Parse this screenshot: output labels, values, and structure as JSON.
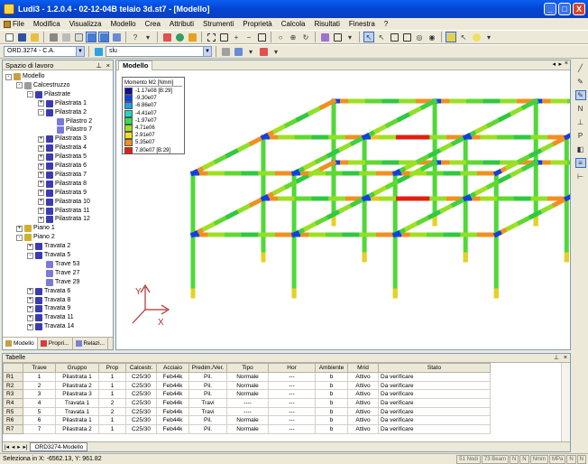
{
  "window": {
    "title": "Ludi3 - 1.2.0.4 - 02-12-04B telaio 3d.st7 - [Modello]",
    "controls": [
      "_",
      "□",
      "X"
    ]
  },
  "menu": [
    "File",
    "Modifica",
    "Visualizza",
    "Modello",
    "Crea",
    "Attributi",
    "Strumenti",
    "Proprietà",
    "Calcola",
    "Risultati",
    "Finestra",
    "?"
  ],
  "toolbar2": {
    "norm_combo": "ORD.3274 - C.A.",
    "case_combo": "slu"
  },
  "workspace": {
    "title": "Spazio di lavoro",
    "tree": [
      {
        "label": "Modello",
        "level": 0,
        "exp": "-",
        "icon": "model-icon",
        "color": "#c8a040"
      },
      {
        "label": "Calcestruzzo",
        "level": 1,
        "exp": "-",
        "icon": "material-icon",
        "color": "#9a9a9a"
      },
      {
        "label": "Pilastrate",
        "level": 2,
        "exp": "-",
        "icon": "column-group-icon",
        "color": "#3c3cb0"
      },
      {
        "label": "Pilastrata 1",
        "level": 3,
        "exp": "+",
        "icon": "column-icon",
        "color": "#3c3cb0"
      },
      {
        "label": "Pilastrata 2",
        "level": 3,
        "exp": "-",
        "icon": "column-icon",
        "color": "#3c3cb0"
      },
      {
        "label": "Pilastro 2",
        "level": 4,
        "exp": "",
        "icon": "element-icon",
        "color": "#7a7ad8"
      },
      {
        "label": "Pilastro 7",
        "level": 4,
        "exp": "",
        "icon": "element-icon",
        "color": "#7a7ad8"
      },
      {
        "label": "Pilastrata 3",
        "level": 3,
        "exp": "+",
        "icon": "column-icon",
        "color": "#3c3cb0"
      },
      {
        "label": "Pilastrata 4",
        "level": 3,
        "exp": "+",
        "icon": "column-icon",
        "color": "#3c3cb0"
      },
      {
        "label": "Pilastrata 5",
        "level": 3,
        "exp": "+",
        "icon": "column-icon",
        "color": "#3c3cb0"
      },
      {
        "label": "Pilastrata 6",
        "level": 3,
        "exp": "+",
        "icon": "column-icon",
        "color": "#3c3cb0"
      },
      {
        "label": "Pilastrata 7",
        "level": 3,
        "exp": "+",
        "icon": "column-icon",
        "color": "#3c3cb0"
      },
      {
        "label": "Pilastrata 8",
        "level": 3,
        "exp": "+",
        "icon": "column-icon",
        "color": "#3c3cb0"
      },
      {
        "label": "Pilastrata 9",
        "level": 3,
        "exp": "+",
        "icon": "column-icon",
        "color": "#3c3cb0"
      },
      {
        "label": "Pilastrata 10",
        "level": 3,
        "exp": "+",
        "icon": "column-icon",
        "color": "#3c3cb0"
      },
      {
        "label": "Pilastrata 11",
        "level": 3,
        "exp": "+",
        "icon": "column-icon",
        "color": "#3c3cb0"
      },
      {
        "label": "Pilastrata 12",
        "level": 3,
        "exp": "+",
        "icon": "column-icon",
        "color": "#3c3cb0"
      },
      {
        "label": "Piano 1",
        "level": 1,
        "exp": "+",
        "icon": "floor-icon",
        "color": "#d0b030"
      },
      {
        "label": "Piano 2",
        "level": 1,
        "exp": "-",
        "icon": "floor-icon",
        "color": "#d0b030"
      },
      {
        "label": "Travata 2",
        "level": 2,
        "exp": "+",
        "icon": "beam-icon",
        "color": "#3c3cb0"
      },
      {
        "label": "Travata 5",
        "level": 2,
        "exp": "-",
        "icon": "beam-icon",
        "color": "#3c3cb0"
      },
      {
        "label": "Trave 53",
        "level": 3,
        "exp": "",
        "icon": "element-icon",
        "color": "#7a7ad8"
      },
      {
        "label": "Trave 27",
        "level": 3,
        "exp": "",
        "icon": "element-icon",
        "color": "#7a7ad8"
      },
      {
        "label": "Trave 29",
        "level": 3,
        "exp": "",
        "icon": "element-icon",
        "color": "#7a7ad8"
      },
      {
        "label": "Travata 6",
        "level": 2,
        "exp": "+",
        "icon": "beam-icon",
        "color": "#3c3cb0"
      },
      {
        "label": "Travata 8",
        "level": 2,
        "exp": "+",
        "icon": "beam-icon",
        "color": "#3c3cb0"
      },
      {
        "label": "Travata 9",
        "level": 2,
        "exp": "+",
        "icon": "beam-icon",
        "color": "#3c3cb0"
      },
      {
        "label": "Travata 11",
        "level": 2,
        "exp": "+",
        "icon": "beam-icon",
        "color": "#3c3cb0"
      },
      {
        "label": "Travata 14",
        "level": 2,
        "exp": "+",
        "icon": "beam-icon",
        "color": "#3c3cb0"
      }
    ],
    "tabs": [
      "Modello",
      "Propri...",
      "Relazi..."
    ]
  },
  "model": {
    "tab": "Modello",
    "legend": {
      "title": "Momento M2 [Nmm]",
      "items": [
        {
          "label": "-1.17e08 [B:29]",
          "color": "#0a10a0"
        },
        {
          "label": "-9.30e07",
          "color": "#1040e0"
        },
        {
          "label": "-6.86e07",
          "color": "#18a0e8"
        },
        {
          "label": "-4.41e07",
          "color": "#20d8c0"
        },
        {
          "label": "-1.97e07",
          "color": "#30e050"
        },
        {
          "label": "4.71e06",
          "color": "#a0e020"
        },
        {
          "label": "2.91e07",
          "color": "#f0e020"
        },
        {
          "label": "5.35e07",
          "color": "#f09020"
        },
        {
          "label": "7.80e07 [B:29]",
          "color": "#e02010"
        }
      ]
    },
    "axis": {
      "x": "X",
      "y": "Y"
    }
  },
  "tables": {
    "title": "Tabelle",
    "columns": [
      "",
      "Trave",
      "Gruppo",
      "Prop",
      "Calcestr.",
      "Acciaio",
      "Predim./Ver.",
      "Tipo",
      "Hor",
      "Ambiente",
      "Mrid",
      "Stato"
    ],
    "rows": [
      [
        "R1",
        "1",
        "Pilastrata 1",
        "1",
        "C25/30",
        "Feb44k",
        "Pil.",
        "Normale",
        "---",
        "b",
        "Attivo",
        "Da verificare"
      ],
      [
        "R2",
        "2",
        "Pilastrata 2",
        "1",
        "C25/30",
        "Feb44k",
        "Pil.",
        "Normale",
        "---",
        "b",
        "Attivo",
        "Da verificare"
      ],
      [
        "R3",
        "3",
        "Pilastrata 3",
        "1",
        "C25/30",
        "Feb44k",
        "Pil.",
        "Normale",
        "---",
        "b",
        "Attivo",
        "Da verificare"
      ],
      [
        "R4",
        "4",
        "Travata 1",
        "2",
        "C25/30",
        "Feb44k",
        "Travi",
        "----",
        "---",
        "b",
        "Attivo",
        "Da verificare"
      ],
      [
        "R5",
        "5",
        "Travata 1",
        "2",
        "C25/30",
        "Feb44k",
        "Travi",
        "----",
        "---",
        "b",
        "Attivo",
        "Da verificare"
      ],
      [
        "R6",
        "6",
        "Pilastrata 1",
        "1",
        "C25/30",
        "Feb44k",
        "Pil.",
        "Normale",
        "---",
        "b",
        "Attivo",
        "Da verificare"
      ],
      [
        "R7",
        "7",
        "Pilastrata 2",
        "1",
        "C25/30",
        "Feb44k",
        "Pil.",
        "Normale",
        "---",
        "b",
        "Attivo",
        "Da verificare"
      ]
    ],
    "sheet_tab": "ORD3274-Modello"
  },
  "status": {
    "coords": "Seleziona in X: -6562.13, Y: 961.82",
    "cells": [
      "51 Nodi",
      "73 Beam",
      "N",
      "N",
      "Nmm",
      "MPa",
      "N",
      "N"
    ]
  }
}
